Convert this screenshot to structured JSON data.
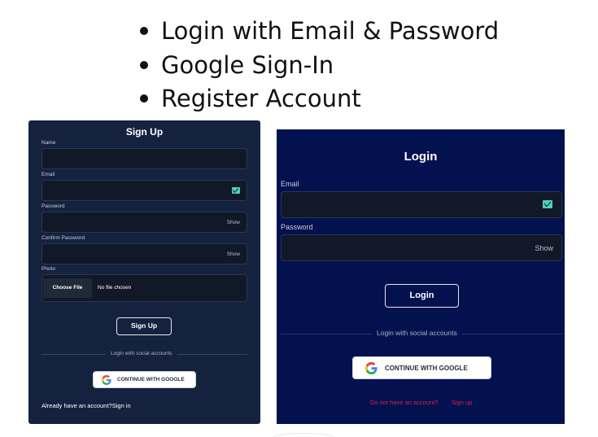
{
  "features": [
    "Login with Email & Password",
    "Google Sign-In",
    "Register Account"
  ],
  "signup": {
    "title": "Sign Up",
    "name_label": "Name",
    "email_label": "Email",
    "password_label": "Password",
    "password_toggle": "Show",
    "confirm_label": "Confirm Password",
    "confirm_toggle": "Show",
    "photo_label": "Photo",
    "choose_file": "Choose File",
    "no_file": "No file chosen",
    "submit": "Sign Up",
    "divider": "Login with social accounts",
    "google": "CONTINUE WITH GOOGLE",
    "already": "Already have an account?Sign in"
  },
  "login": {
    "title": "Login",
    "email_label": "Email",
    "password_label": "Password",
    "password_toggle": "Show",
    "submit": "Login",
    "divider": "Login with social accounts",
    "google": "CONTINUE WITH GOOGLE",
    "no_account": "Do not have an account?",
    "signup_link": "Sign up"
  },
  "colors": {
    "signup_bg": "#15223f",
    "login_bg": "#03114f",
    "accent_red": "#e11d48",
    "mail_icon": "#4fd1b2"
  }
}
